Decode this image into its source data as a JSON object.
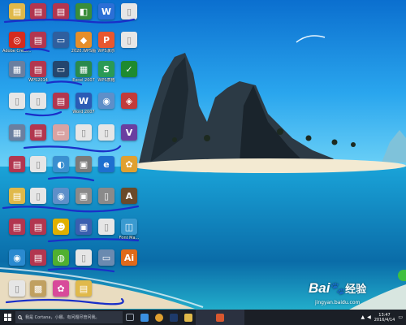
{
  "desktop": {
    "icons": [
      {
        "caption": "",
        "color": "#e0b94a",
        "glyph": "▤"
      },
      {
        "caption": "",
        "color": "#b2364f",
        "glyph": "▤"
      },
      {
        "caption": "",
        "color": "#b2364f",
        "glyph": "▤"
      },
      {
        "caption": "",
        "color": "#3a8d3a",
        "glyph": "◧"
      },
      {
        "caption": "",
        "color": "#2b6fd6",
        "glyph": "W"
      },
      {
        "caption": "",
        "color": "#e6e6e6",
        "glyph": "▯"
      },
      {
        "caption": "Adobe Creati...",
        "color": "#d52b1e",
        "glyph": "◎"
      },
      {
        "caption": "",
        "color": "#b2364f",
        "glyph": "▤"
      },
      {
        "caption": "",
        "color": "#2f5f9e",
        "glyph": "▭"
      },
      {
        "caption": "2020.WPS版",
        "color": "#e58e2a",
        "glyph": "◆"
      },
      {
        "caption": "WPS演示",
        "color": "#e8572f",
        "glyph": "P"
      },
      {
        "caption": "",
        "color": "#e6e6e6",
        "glyph": "▯"
      },
      {
        "caption": "",
        "color": "#6a7fa0",
        "glyph": "▦"
      },
      {
        "caption": "WPS2014",
        "color": "#b2364f",
        "glyph": "▤"
      },
      {
        "caption": "",
        "color": "#24466e",
        "glyph": "▭"
      },
      {
        "caption": "Excel 2007",
        "color": "#2a8a4c",
        "glyph": "▦"
      },
      {
        "caption": "WPS表格",
        "color": "#2a9a55",
        "glyph": "S"
      },
      {
        "caption": "",
        "color": "#1e8a2f",
        "glyph": "✓"
      },
      {
        "caption": "",
        "color": "#e6e6e6",
        "glyph": "▯"
      },
      {
        "caption": "",
        "color": "#e6e6e6",
        "glyph": "▯"
      },
      {
        "caption": "",
        "color": "#b2364f",
        "glyph": "▤"
      },
      {
        "caption": "Word 2007",
        "color": "#2b5bb5",
        "glyph": "W"
      },
      {
        "caption": "",
        "color": "#5e8fc9",
        "glyph": "◉"
      },
      {
        "caption": "",
        "color": "#c23b3b",
        "glyph": "◈"
      },
      {
        "caption": "",
        "color": "#6a7fa0",
        "glyph": "▦"
      },
      {
        "caption": "",
        "color": "#b2364f",
        "glyph": "▤"
      },
      {
        "caption": "",
        "color": "#d9a3a3",
        "glyph": "▭"
      },
      {
        "caption": "",
        "color": "#e6e6e6",
        "glyph": "▯"
      },
      {
        "caption": "",
        "color": "#e6e6e6",
        "glyph": "▯"
      },
      {
        "caption": "",
        "color": "#6a3fa0",
        "glyph": "V"
      },
      {
        "caption": "",
        "color": "#b2364f",
        "glyph": "▤"
      },
      {
        "caption": "",
        "color": "#e6e6e6",
        "glyph": "▯"
      },
      {
        "caption": "",
        "color": "#3a8fd0",
        "glyph": "◐"
      },
      {
        "caption": "",
        "color": "#7a7a7a",
        "glyph": "▣"
      },
      {
        "caption": "",
        "color": "#1e6fd0",
        "glyph": "e"
      },
      {
        "caption": "",
        "color": "#e0a030",
        "glyph": "✿"
      },
      {
        "caption": "",
        "color": "#e0b94a",
        "glyph": "▤"
      },
      {
        "caption": "",
        "color": "#e6e6e6",
        "glyph": "▯"
      },
      {
        "caption": "",
        "color": "#5e8fc9",
        "glyph": "◉"
      },
      {
        "caption": "",
        "color": "#8a8a8a",
        "glyph": "▣"
      },
      {
        "caption": "",
        "color": "#8a8a8a",
        "glyph": "▯"
      },
      {
        "caption": "",
        "color": "#6a4a2a",
        "glyph": "A"
      },
      {
        "caption": "",
        "color": "#b2364f",
        "glyph": "▤"
      },
      {
        "caption": "",
        "color": "#b2364f",
        "glyph": "▤"
      },
      {
        "caption": "",
        "color": "#e0b000",
        "glyph": "☻"
      },
      {
        "caption": "",
        "color": "#3a5fb0",
        "glyph": "▣"
      },
      {
        "caption": "",
        "color": "#e6e6e6",
        "glyph": "▯"
      },
      {
        "caption": "Font Ma...",
        "color": "#3a9ad0",
        "glyph": "◫"
      },
      {
        "caption": "",
        "color": "#2a8ad0",
        "glyph": "◉"
      },
      {
        "caption": "",
        "color": "#b2364f",
        "glyph": "▤"
      },
      {
        "caption": "",
        "color": "#50b030",
        "glyph": "◍"
      },
      {
        "caption": "",
        "color": "#e6e6e6",
        "glyph": "▯"
      },
      {
        "caption": "",
        "color": "#6a8ab0",
        "glyph": "▭"
      },
      {
        "caption": "",
        "color": "#e06a1a",
        "glyph": "Ai"
      },
      {
        "caption": "",
        "color": "#e6e6e6",
        "glyph": "▯"
      },
      {
        "caption": "",
        "color": "#c0a060",
        "glyph": "▩"
      },
      {
        "caption": "",
        "color": "#d84a9a",
        "glyph": "✿"
      },
      {
        "caption": "",
        "color": "#e0b94a",
        "glyph": "▤"
      }
    ]
  },
  "taskbar": {
    "start_icon": "windows-logo-icon",
    "search_text": "我是 Cortana，小娜。有问题尽管问我。",
    "apps": [
      {
        "name": "task-view-icon",
        "color": "#9aa3b0"
      },
      {
        "name": "edge-icon",
        "color": "#3a8fe0"
      },
      {
        "name": "chrome-icon",
        "color": "#e0a030"
      },
      {
        "name": "photoshop-icon",
        "color": "#1e3a6a"
      },
      {
        "name": "folder-icon",
        "color": "#e0b94a"
      },
      {
        "name": "app-icon",
        "color": "#d8572f"
      }
    ],
    "clock_time": "13:47",
    "clock_date": "2016/4/14"
  },
  "watermark": {
    "brand": "Bai",
    "brand2": "经验",
    "sub": "jingyan.baidu.com"
  }
}
